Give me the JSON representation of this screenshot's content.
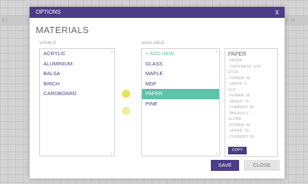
{
  "background": {
    "ruler_left": "8  1",
    "ruler_right": "1 16"
  },
  "dialog": {
    "title": "OPTIONS",
    "close_label": "X",
    "heading": "MATERIALS",
    "visible_label": "VISIBLE",
    "available_label": "AVAILABLE",
    "visible_items": [
      "ACRYLIC",
      "ALUMINIUM",
      "BALSA",
      "BIRCH",
      "CARDBOARD"
    ],
    "available_items": [
      "+ ADD NEW",
      "GLASS",
      "MAPLE",
      "MDF",
      "PAPER",
      "PINE"
    ],
    "selected_available": "PAPER",
    "details": {
      "name": "PAPER",
      "lines": [
        "PAPER",
        "THICKNESS: 1/16\"",
        "ETCH",
        "POWER: 20",
        "SPEED: 2",
        "CUT",
        "POWER: 20",
        "SPEED: 70",
        "CURRENT: 50",
        "PASSES: 2",
        "SCORE",
        "POWER: 20",
        "SPEED: 30",
        "CURRENT: 30"
      ],
      "copy_label": "COPY"
    },
    "save_label": "SAVE",
    "close_button_label": "CLOSE"
  },
  "colors": {
    "brand": "#4a3c87",
    "selected": "#5fc1a9",
    "arrow_button": "#e3e45a"
  }
}
